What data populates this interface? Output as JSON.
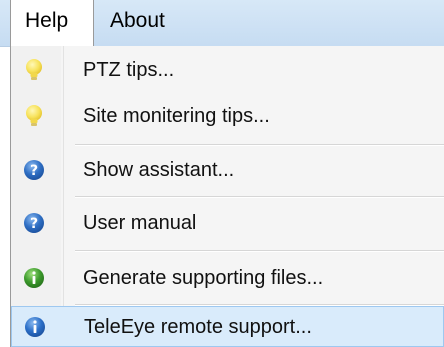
{
  "menubar": {
    "help_label": "Help",
    "about_label": "About"
  },
  "menu": {
    "items": [
      {
        "label": "PTZ tips...",
        "icon": "lightbulb-icon"
      },
      {
        "label": "Site monitering tips...",
        "icon": "lightbulb-icon"
      },
      {
        "label": "Show assistant...",
        "icon": "help-question-icon"
      },
      {
        "label": "User manual",
        "icon": "help-question-icon"
      },
      {
        "label": "Generate supporting files...",
        "icon": "info-green-icon"
      },
      {
        "label": "TeleEye remote support...",
        "icon": "info-blue-icon",
        "highlighted": true
      }
    ]
  },
  "colors": {
    "menubar_bg": "#c9def3",
    "highlight_bg": "#d9ebfb",
    "highlight_border": "#9ec8f0",
    "bulb_yellow": "#f7e25a",
    "question_blue": "#2f6fc4",
    "info_green": "#3c9a2c",
    "info_blue": "#2b6fc8"
  }
}
